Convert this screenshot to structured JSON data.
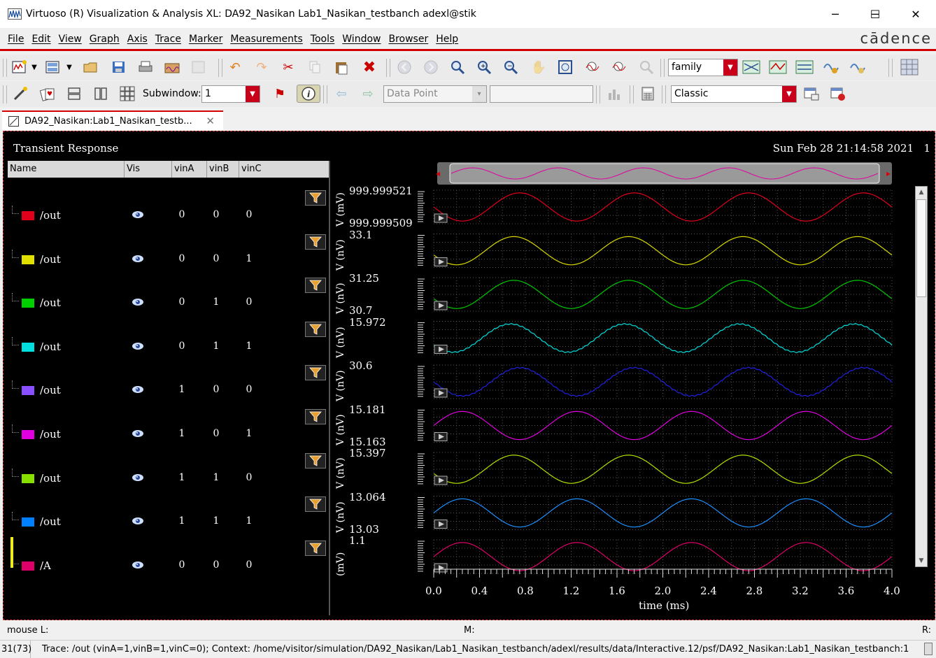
{
  "window": {
    "title": "Virtuoso (R) Visualization & Analysis XL: DA92_Nasikan Lab1_Nasikan_testbanch adexl@stik",
    "minimize": "─",
    "maximize": "☐",
    "close": "✕"
  },
  "menu": {
    "items": [
      "File",
      "Edit",
      "View",
      "Graph",
      "Axis",
      "Trace",
      "Marker",
      "Measurements",
      "Tools",
      "Window",
      "Browser",
      "Help"
    ],
    "brand": "cādence"
  },
  "toolbar": {
    "family_combo": "family",
    "subwindow_label": "Subwindow:",
    "subwindow_value": "1",
    "datapoint_combo": "Data Point",
    "style_combo": "Classic"
  },
  "tab": {
    "label": "DA92_Nasikan:Lab1_Nasikan_testb...",
    "close": "✕"
  },
  "plot": {
    "title": "Transient Response",
    "timestamp": "Sun Feb 28 21:14:58 2021",
    "page_index": "1",
    "legend_headers": [
      "Name",
      "Vis",
      "vinA",
      "vinB",
      "vinC"
    ],
    "legend": [
      {
        "name": "/out",
        "color": "#e3001b",
        "vinA": "0",
        "vinB": "0",
        "vinC": "0"
      },
      {
        "name": "/out",
        "color": "#e0e000",
        "vinA": "0",
        "vinB": "0",
        "vinC": "1"
      },
      {
        "name": "/out",
        "color": "#00d000",
        "vinA": "0",
        "vinB": "1",
        "vinC": "0"
      },
      {
        "name": "/out",
        "color": "#00e0e0",
        "vinA": "0",
        "vinB": "1",
        "vinC": "1"
      },
      {
        "name": "/out",
        "color": "#8a4fff",
        "vinA": "1",
        "vinB": "0",
        "vinC": "0"
      },
      {
        "name": "/out",
        "color": "#e000e0",
        "vinA": "1",
        "vinB": "0",
        "vinC": "1"
      },
      {
        "name": "/out",
        "color": "#88e000",
        "vinA": "1",
        "vinB": "1",
        "vinC": "0"
      },
      {
        "name": "/out",
        "color": "#0080ff",
        "vinA": "1",
        "vinB": "1",
        "vinC": "1"
      },
      {
        "name": "/A",
        "color": "#e0006a",
        "vinA": "0",
        "vinB": "0",
        "vinC": "0"
      }
    ],
    "strip_units": [
      "V (mV)",
      "V (nV)",
      "V (nV)",
      "V (nV)",
      "V (nV)",
      "V (nV)",
      "V (nV)",
      "V (nV)",
      "(mV)"
    ],
    "strip_ticks": [
      [
        "999.999521",
        "999.999509"
      ],
      [
        "33.1",
        ""
      ],
      [
        "31.25",
        "30.7"
      ],
      [
        "15.972",
        ""
      ],
      [
        "30.6",
        ""
      ],
      [
        "15.181",
        "15.163"
      ],
      [
        "15.397",
        ""
      ],
      [
        "13.064",
        "13.03"
      ],
      [
        "1.1",
        ""
      ]
    ],
    "strip_colors": [
      "#e3001b",
      "#d8d800",
      "#00c800",
      "#00dcdc",
      "#2020e0",
      "#e000e0",
      "#b0e000",
      "#1e90ff",
      "#e0006a"
    ],
    "x_ticks": [
      "0.0",
      "0.4",
      "0.8",
      "1.2",
      "1.6",
      "2.0",
      "2.4",
      "2.8",
      "3.2",
      "3.6",
      "4.0"
    ],
    "x_label": "time (ms)"
  },
  "status": {
    "mouse_l": "mouse L:",
    "mouse_m": "M:",
    "mouse_r": "R:",
    "counter": "31(73)",
    "message": "Trace: /out (vinA=1,vinB=1,vinC=0); Context: /home/visitor/simulation/DA92_Nasikan/Lab1_Nasikan_testbanch/adexl/results/data/Interactive.12/psf/DA92_Nasikan:Lab1_Nasikan_testbanch:1"
  },
  "chart_data": {
    "type": "line",
    "title": "Transient Response",
    "xlabel": "time (ms)",
    "ylabel": "",
    "xlim": [
      0.0,
      4.0
    ],
    "x": [
      0.0,
      0.4,
      0.8,
      1.2,
      1.6,
      2.0,
      2.4,
      2.8,
      3.2,
      3.6,
      4.0
    ],
    "series": [
      {
        "name": "/out (vinA=0,vinB=0,vinC=0)",
        "unit": "mV",
        "ylim": [
          999.999509,
          999.999521
        ]
      },
      {
        "name": "/out (vinA=0,vinB=0,vinC=1)",
        "unit": "nV",
        "ylim": [
          33.1,
          33.1
        ]
      },
      {
        "name": "/out (vinA=0,vinB=1,vinC=0)",
        "unit": "nV",
        "ylim": [
          30.7,
          31.25
        ]
      },
      {
        "name": "/out (vinA=0,vinB=1,vinC=1)",
        "unit": "nV",
        "ylim": [
          15.972,
          15.972
        ]
      },
      {
        "name": "/out (vinA=1,vinB=0,vinC=0)",
        "unit": "nV",
        "ylim": [
          30.6,
          30.6
        ]
      },
      {
        "name": "/out (vinA=1,vinB=0,vinC=1)",
        "unit": "nV",
        "ylim": [
          15.163,
          15.181
        ]
      },
      {
        "name": "/out (vinA=1,vinB=1,vinC=0)",
        "unit": "nV",
        "ylim": [
          15.397,
          15.397
        ]
      },
      {
        "name": "/out (vinA=1,vinB=1,vinC=1)",
        "unit": "nV",
        "ylim": [
          13.03,
          13.064
        ]
      },
      {
        "name": "/A",
        "unit": "mV",
        "ylim": [
          1.1,
          1.1
        ]
      }
    ],
    "period_ms": 1.0,
    "grid": true
  }
}
